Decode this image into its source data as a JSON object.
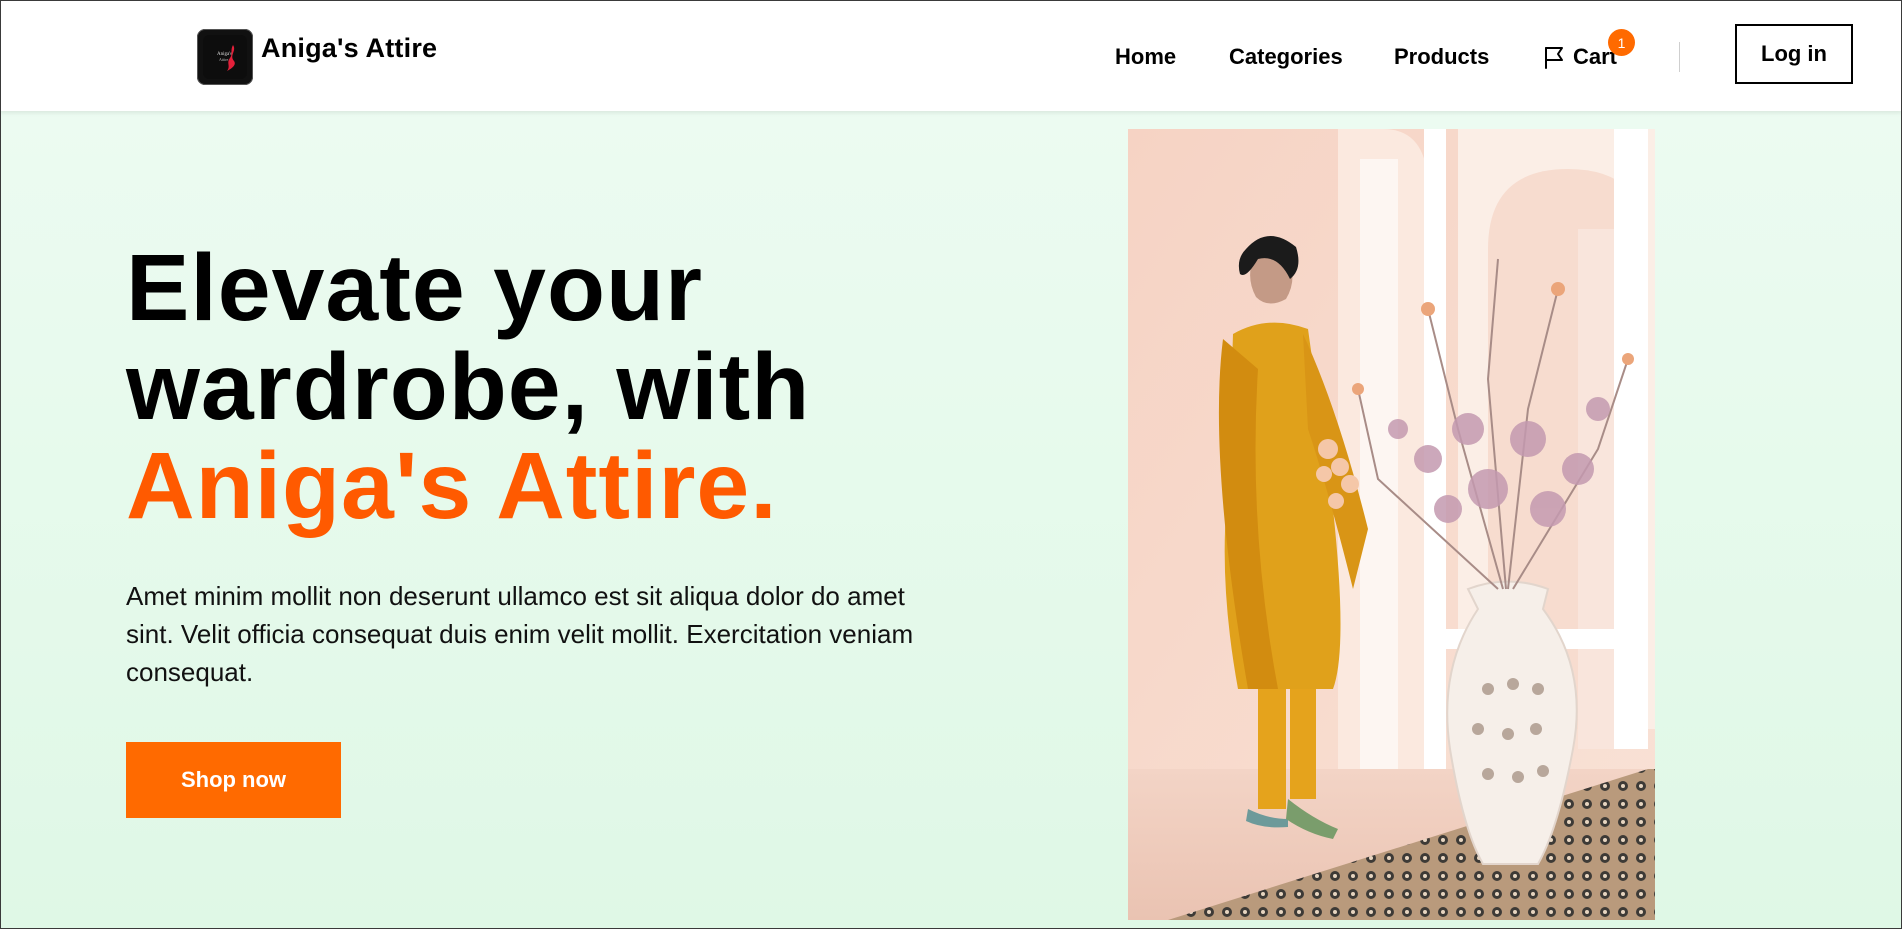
{
  "header": {
    "brand": "Aniga's Attire",
    "logo_icon": "aniga-logo-icon",
    "nav": {
      "home": "Home",
      "categories": "Categories",
      "products": "Products"
    },
    "cart": {
      "label": "Cart",
      "count": "1",
      "icon": "flag-icon"
    },
    "login_label": "Log in"
  },
  "hero": {
    "headline_line1": "Elevate your",
    "headline_line2": "wardrobe, with",
    "headline_accent": "Aniga's Attire.",
    "description": "Amet minim mollit non deserunt ullamco est sit aliqua dolor do amet sint. Velit officia consequat duis enim velit mollit. Exercitation veniam consequat.",
    "cta_label": "Shop now",
    "image_alt": "Model in mustard outfit beside vase"
  },
  "colors": {
    "accent": "#ff6a00",
    "accent_text": "#ff5a00",
    "hero_bg": "#e6fbee"
  }
}
